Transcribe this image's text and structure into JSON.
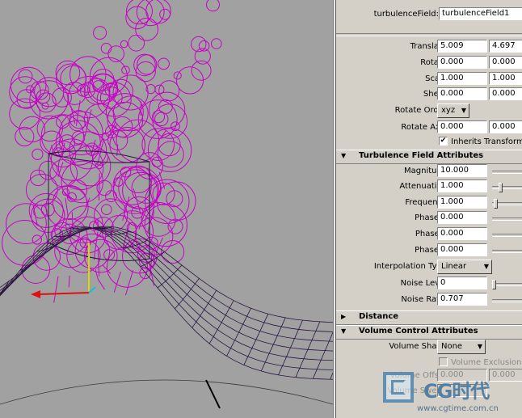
{
  "header": {
    "name_label": "turbulenceField:",
    "name_value": "turbulenceField1"
  },
  "transform": {
    "translate": {
      "label": "Translate",
      "x": "5.009",
      "y": "4.697"
    },
    "rotate": {
      "label": "Rotate",
      "x": "0.000",
      "y": "0.000"
    },
    "scale": {
      "label": "Scale",
      "x": "1.000",
      "y": "1.000"
    },
    "shear": {
      "label": "Shear",
      "x": "0.000",
      "y": "0.000"
    },
    "rotate_order": {
      "label": "Rotate Order",
      "value": "xyz"
    },
    "rotate_axis": {
      "label": "Rotate Axis",
      "x": "0.000",
      "y": "0.000"
    },
    "inherits": {
      "label": "Inherits Transform",
      "checked": "✔"
    }
  },
  "turbulence_section": {
    "title": "Turbulence Field Attributes",
    "magnitude": {
      "label": "Magnitude",
      "value": "10.000"
    },
    "attenuation": {
      "label": "Attenuation",
      "value": "1.000"
    },
    "frequency": {
      "label": "Frequency",
      "value": "1.000"
    },
    "phase_x": {
      "label": "Phase X",
      "value": "0.000"
    },
    "phase_y": {
      "label": "Phase Y",
      "value": "0.000"
    },
    "phase_z": {
      "label": "Phase Z",
      "value": "0.000"
    },
    "interpolation": {
      "label": "Interpolation Type",
      "value": "Linear"
    },
    "noise_level": {
      "label": "Noise Level",
      "value": "0"
    },
    "noise_ratio": {
      "label": "Noise Ratio",
      "value": "0.707"
    }
  },
  "distance_section": {
    "title": "Distance"
  },
  "volume_section": {
    "title": "Volume Control Attributes",
    "volume_shape": {
      "label": "Volume Shape",
      "value": "None"
    },
    "volume_exclusion": {
      "label": "Volume Exclusion"
    },
    "volume_offset": {
      "label": "Volume Offset",
      "x": "0.000",
      "y": "0.000"
    },
    "volume_sweep": {
      "label": "Volume Sweep"
    }
  },
  "watermark": {
    "brand": "CG时代",
    "url": "www.cgtime.com.cn"
  },
  "colors": {
    "particles": "#c800c8",
    "wire": "#2a1440",
    "viewport_bg": "#a1a1a1",
    "panel_bg": "#d4d0c8"
  },
  "icons": [
    "expand-triangle-icon",
    "collapse-triangle-icon",
    "dropdown-arrow-icon",
    "checkbox-icon"
  ]
}
